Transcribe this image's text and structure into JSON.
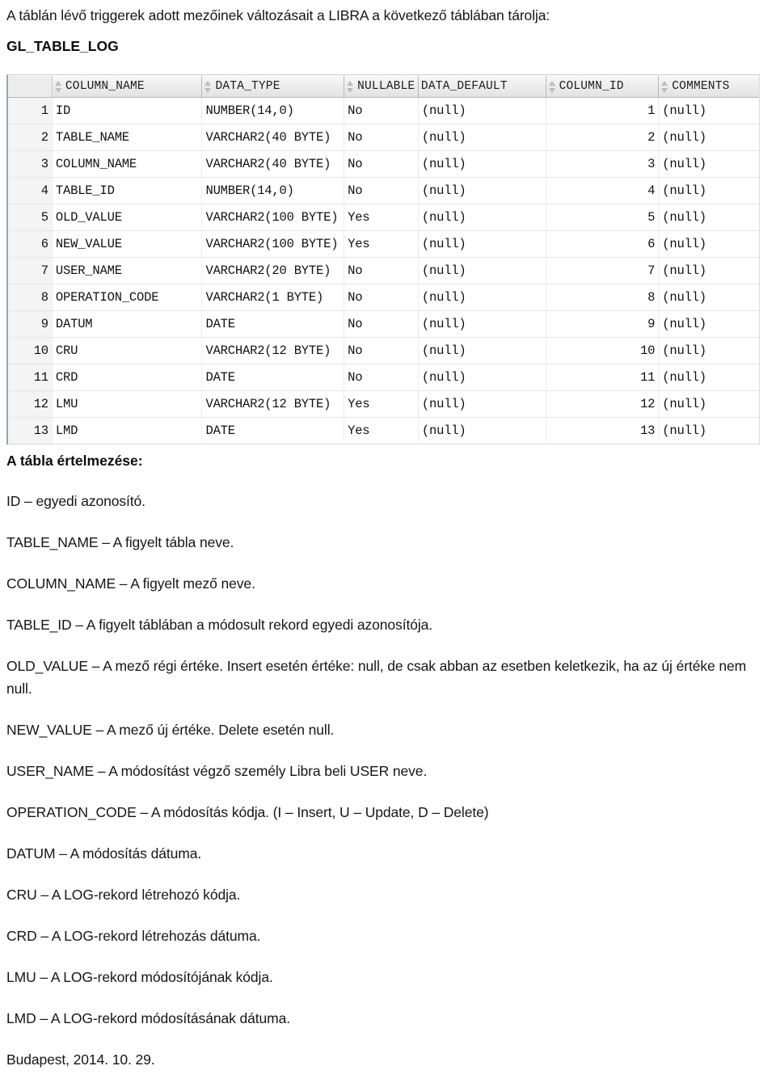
{
  "document": {
    "intro_paragraph": "A táblán lévő triggerek adott mezőinek változásait a LIBRA a következő táblában tárolja:",
    "table_title": "GL_TABLE_LOG",
    "footer_date": "Budapest, 2014. 10. 29."
  },
  "grid": {
    "columns": [
      {
        "key": "rownum",
        "label": "",
        "sortable": false
      },
      {
        "key": "column_name",
        "label": "COLUMN_NAME",
        "sortable": true
      },
      {
        "key": "data_type",
        "label": "DATA_TYPE",
        "sortable": true
      },
      {
        "key": "nullable",
        "label": "NULLABLE",
        "sortable": true
      },
      {
        "key": "data_default",
        "label": "DATA_DEFAULT",
        "sortable": false
      },
      {
        "key": "column_id",
        "label": "COLUMN_ID",
        "sortable": true
      },
      {
        "key": "comments",
        "label": "COMMENTS",
        "sortable": true
      }
    ],
    "rows": [
      {
        "n": "1",
        "column_name": "ID",
        "data_type": "NUMBER(14,0)",
        "nullable": "No",
        "data_default": "(null)",
        "column_id": "1",
        "comments": "(null)"
      },
      {
        "n": "2",
        "column_name": "TABLE_NAME",
        "data_type": "VARCHAR2(40 BYTE)",
        "nullable": "No",
        "data_default": "(null)",
        "column_id": "2",
        "comments": "(null)"
      },
      {
        "n": "3",
        "column_name": "COLUMN_NAME",
        "data_type": "VARCHAR2(40 BYTE)",
        "nullable": "No",
        "data_default": "(null)",
        "column_id": "3",
        "comments": "(null)"
      },
      {
        "n": "4",
        "column_name": "TABLE_ID",
        "data_type": "NUMBER(14,0)",
        "nullable": "No",
        "data_default": "(null)",
        "column_id": "4",
        "comments": "(null)"
      },
      {
        "n": "5",
        "column_name": "OLD_VALUE",
        "data_type": "VARCHAR2(100 BYTE)",
        "nullable": "Yes",
        "data_default": "(null)",
        "column_id": "5",
        "comments": "(null)"
      },
      {
        "n": "6",
        "column_name": "NEW_VALUE",
        "data_type": "VARCHAR2(100 BYTE)",
        "nullable": "Yes",
        "data_default": "(null)",
        "column_id": "6",
        "comments": "(null)"
      },
      {
        "n": "7",
        "column_name": "USER_NAME",
        "data_type": "VARCHAR2(20 BYTE)",
        "nullable": "No",
        "data_default": "(null)",
        "column_id": "7",
        "comments": "(null)"
      },
      {
        "n": "8",
        "column_name": "OPERATION_CODE",
        "data_type": "VARCHAR2(1 BYTE)",
        "nullable": "No",
        "data_default": "(null)",
        "column_id": "8",
        "comments": "(null)"
      },
      {
        "n": "9",
        "column_name": "DATUM",
        "data_type": "DATE",
        "nullable": "No",
        "data_default": "(null)",
        "column_id": "9",
        "comments": "(null)"
      },
      {
        "n": "10",
        "column_name": "CRU",
        "data_type": "VARCHAR2(12 BYTE)",
        "nullable": "No",
        "data_default": "(null)",
        "column_id": "10",
        "comments": "(null)"
      },
      {
        "n": "11",
        "column_name": "CRD",
        "data_type": "DATE",
        "nullable": "No",
        "data_default": "(null)",
        "column_id": "11",
        "comments": "(null)"
      },
      {
        "n": "12",
        "column_name": "LMU",
        "data_type": "VARCHAR2(12 BYTE)",
        "nullable": "Yes",
        "data_default": "(null)",
        "column_id": "12",
        "comments": "(null)"
      },
      {
        "n": "13",
        "column_name": "LMD",
        "data_type": "DATE",
        "nullable": "Yes",
        "data_default": "(null)",
        "column_id": "13",
        "comments": "(null)"
      }
    ]
  },
  "description": {
    "heading": "A tábla értelmezése:",
    "entries": [
      "ID – egyedi azonosító.",
      "TABLE_NAME – A figyelt tábla neve.",
      "COLUMN_NAME – A figyelt mező neve.",
      "TABLE_ID – A figyelt táblában a módosult rekord egyedi azonosítója.",
      "OLD_VALUE – A mező régi értéke. Insert esetén értéke: null, de csak abban az esetben keletkezik, ha az új értéke nem null.",
      "NEW_VALUE – A mező új értéke. Delete esetén null.",
      "USER_NAME – A módosítást végző személy Libra beli USER neve.",
      "OPERATION_CODE – A módosítás kódja. (I – Insert, U – Update, D – Delete)",
      "DATUM – A  módosítás dátuma.",
      "CRU – A LOG-rekord létrehozó kódja.",
      "CRD – A LOG-rekord létrehozás dátuma.",
      "LMU – A LOG-rekord módosítójának kódja.",
      "LMD – A LOG-rekord módosításának dátuma."
    ]
  },
  "colors": {
    "page_background": "#ffffff",
    "text": "#161616",
    "grid_header_background": "#ececec",
    "grid_border": "#b4b8bc",
    "grid_left_edge": "#9aa3ab",
    "sort_icon": "#b9bcc0"
  }
}
